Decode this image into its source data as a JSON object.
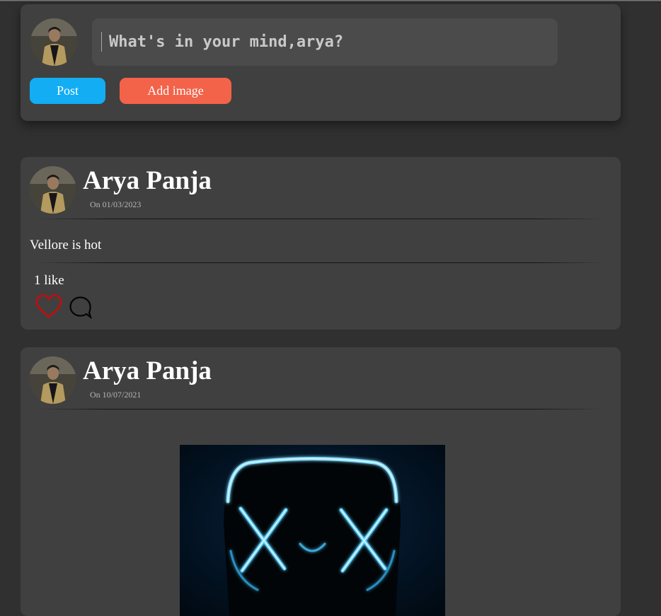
{
  "composer": {
    "placeholder": "What's in your mind,arya?",
    "post_label": "Post",
    "add_image_label": "Add image"
  },
  "posts": [
    {
      "author": "Arya Panja",
      "date": "On 01/03/2023",
      "text": "Vellore is hot",
      "likes": "1 like"
    },
    {
      "author": "Arya Panja",
      "date": "On 10/07/2021"
    }
  ],
  "colors": {
    "background": "#303030",
    "card": "#404040",
    "input": "#4c4b4b",
    "post_button": "#12adf3",
    "add_image_button": "#f2634a",
    "heart": "#c40c0c"
  },
  "icons": [
    "avatar",
    "heart-icon",
    "comment-icon"
  ]
}
